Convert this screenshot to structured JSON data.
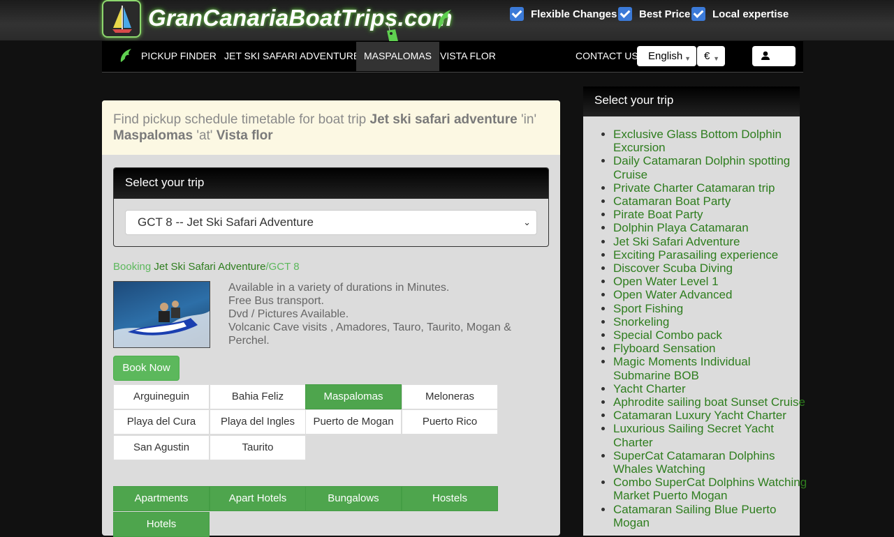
{
  "header": {
    "logo_text": "GranCanariaBoatTrips.com",
    "features": [
      "Flexible Changes",
      "Best Price",
      "Local expertise"
    ]
  },
  "nav": {
    "items": [
      "PICKUP FINDER",
      "JET SKI SAFARI ADVENTURE",
      "MASPALOMAS",
      "VISTA FLOR"
    ],
    "active_index": 2,
    "contact": "CONTACT US",
    "language": "English",
    "currency": "€"
  },
  "notice": {
    "p1": "Find pickup schedule timetable for boat trip ",
    "trip": "Jet ski safari adventure",
    "p2": " 'in' ",
    "area": "Maspalomas",
    "p3": " 'at' ",
    "place": "Vista flor"
  },
  "trip_panel": {
    "heading": "Select your trip",
    "selected": "GCT 8 -- Jet Ski Safari Adventure"
  },
  "breadcrumb": {
    "prefix": "Booking ",
    "trip": "Jet Ski Safari Adventure",
    "code": "/GCT 8"
  },
  "description": [
    "Available in a variety of durations in Minutes.",
    "Free Bus transport.",
    "Dvd / Pictures Available.",
    "Volcanic Cave visits , Amadores, Tauro, Taurito, Mogan & Perchel."
  ],
  "book_button": "Book Now",
  "locations": [
    "Arguineguin",
    "Bahia Feliz",
    "Maspalomas",
    "Meloneras",
    "Playa del Cura",
    "Playa del Ingles",
    "Puerto de Mogan",
    "Puerto Rico",
    "San Agustin",
    "Taurito"
  ],
  "active_location_index": 2,
  "categories": [
    "Apartments",
    "Apart Hotels",
    "Bungalows",
    "Hostels",
    "Hotels"
  ],
  "sidebar": {
    "heading": "Select your trip",
    "trips": [
      "Exclusive Glass Bottom Dolphin Excursion",
      "Daily Catamaran Dolphin spotting Cruise",
      "Private Charter Catamaran trip",
      "Catamaran Boat Party",
      "Pirate Boat Party",
      "Dolphin Playa Catamaran",
      "Jet Ski Safari Adventure",
      "Exciting Parasailing experience",
      "Discover Scuba Diving",
      "Open Water Level 1",
      "Open Water Advanced",
      "Sport Fishing",
      "Snorkeling",
      "Special Combo pack",
      "Flyboard Sensation",
      "Magic Moments Individual Submarine BOB",
      "Yacht Charter",
      "Aphrodite sailing boat Sunset Cruise",
      "Catamaran Luxury Yacht Charter",
      "Luxurious Sailing Secret Yacht Charter",
      "SuperCat Catamaran Dolphins Whales Watching",
      "Combo SuperCat Dolphins Watching Market Puerto Mogan",
      "Catamaran Sailing Blue Puerto Mogan"
    ]
  }
}
